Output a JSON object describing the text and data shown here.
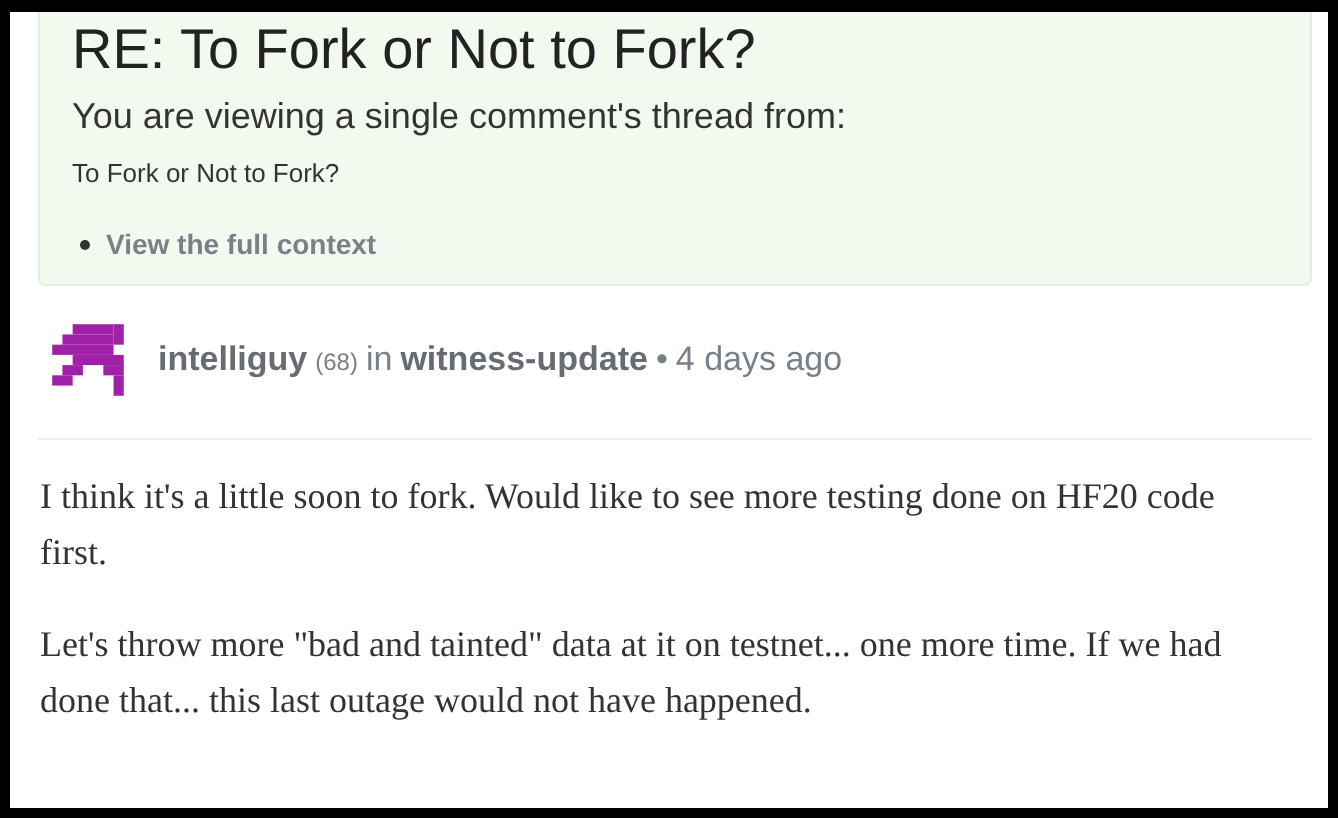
{
  "thread_notice": {
    "title": "RE: To Fork or Not to Fork?",
    "intro": "You are viewing a single comment's thread from:",
    "parent_title": "To Fork or Not to Fork?",
    "context_link": "View the full context"
  },
  "comment": {
    "author": "intelliguy",
    "reputation": "(68)",
    "in_label": "in",
    "category": "witness-update",
    "separator": "•",
    "time": "4 days ago",
    "paragraphs": [
      "I think it's a little soon to fork. Would like to see more testing done on HF20 code first.",
      "Let's throw more \"bad and tainted\" data at it on testnet... one more time. If we had done that... this last outage would not have happened."
    ]
  }
}
